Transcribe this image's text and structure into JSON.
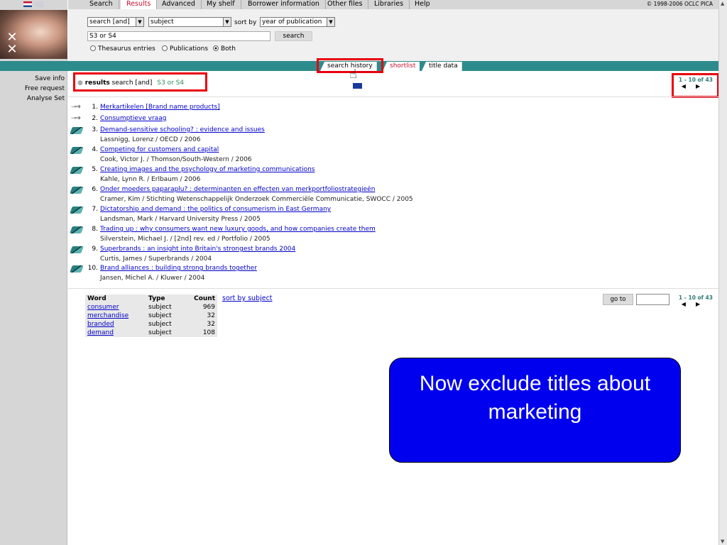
{
  "nav": {
    "items": [
      "Search",
      "Results",
      "Advanced",
      "My shelf",
      "Borrower information",
      "Other files",
      "Libraries",
      "Help"
    ],
    "active": "Results",
    "copyright": "© 1998-2006 OCLC PICA"
  },
  "sidebar": {
    "links": [
      "Save info",
      "Free request",
      "Analyse Set"
    ]
  },
  "search": {
    "operator": "search [and]",
    "field": "subject",
    "sort_label": "sort by",
    "sort_value": "year of publication",
    "query": "S3 or S4",
    "button": "search",
    "radios": [
      "Thesaurus entries",
      "Publications",
      "Both"
    ],
    "selected_radio": "Both"
  },
  "tabs": [
    "search history",
    "shortlist",
    "title data"
  ],
  "results_header": {
    "label": "results",
    "mode": "search [and]",
    "query": "S3 or S4"
  },
  "pager": {
    "range": "1 - 10 of 43",
    "prev": "◀",
    "next": "▶"
  },
  "results": [
    {
      "num": "1.",
      "title": "Merkartikelen [Brand name products]",
      "author": "",
      "icon": "key-icon"
    },
    {
      "num": "2.",
      "title": "Consumptieve vraag",
      "author": "",
      "icon": "key-icon"
    },
    {
      "num": "3.",
      "title": "Demand-sensitive schooling? : evidence and issues",
      "author": "Lassnigg, Lorenz / OECD / 2006",
      "icon": "book-icon"
    },
    {
      "num": "4.",
      "title": "Competing for customers and capital",
      "author": "Cook, Victor J. / Thomson/South-Western / 2006",
      "icon": "book-icon"
    },
    {
      "num": "5.",
      "title": "Creating images and the psychology of marketing communications",
      "author": "Kahle, Lynn R. / Erlbaum / 2006",
      "icon": "book-icon"
    },
    {
      "num": "6.",
      "title": "Onder moeders paparaplu? : determinanten en effecten van merkportfoliostrategieën",
      "author": "Cramer, Kim / Stichting Wetenschappelijk Onderzoek Commerciële Communicatie, SWOCC / 2005",
      "icon": "book-icon"
    },
    {
      "num": "7.",
      "title": "Dictatorship and demand : the politics of consumerism in East Germany",
      "author": "Landsman, Mark / Harvard University Press / 2005",
      "icon": "book-icon"
    },
    {
      "num": "8.",
      "title": "Trading up : why consumers want new luxury goods, and how companies create them",
      "author": "Silverstein, Michael J. / [2nd] rev. ed / Portfolio / 2005",
      "icon": "book-icon"
    },
    {
      "num": "9.",
      "title": "Superbrands : an insight into Britain's strongest brands 2004",
      "author": "Curtis, James / Superbrands / 2004",
      "icon": "book-icon"
    },
    {
      "num": "10.",
      "title": "Brand alliances : building strong brands together",
      "author": "Jansen, Michel A. / Kluwer / 2004",
      "icon": "book-icon"
    }
  ],
  "word_table": {
    "headers": [
      "Word",
      "Type",
      "Count"
    ],
    "rows": [
      [
        "consumer",
        "subject",
        "969"
      ],
      [
        "merchandise",
        "subject",
        "32"
      ],
      [
        "branded",
        "subject",
        "32"
      ],
      [
        "demand",
        "subject",
        "108"
      ]
    ],
    "sort_link": "sort by subject"
  },
  "goto": {
    "label": "go to",
    "value": ""
  },
  "callout": "Now exclude titles about marketing",
  "colors": {
    "teal": "#2e8b8b",
    "highlight": "#e8000e",
    "callout": "#0000ee",
    "link": "#0000cc"
  }
}
